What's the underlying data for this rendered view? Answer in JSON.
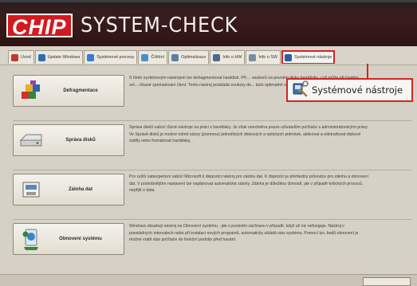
{
  "header": {
    "logo_text": "CHIP",
    "title": "SYSTEM-CHECK"
  },
  "tabs": [
    {
      "label": "Úvod",
      "icon": "home-icon",
      "color": "#c0392b"
    },
    {
      "label": "Update Windows",
      "icon": "globe-icon",
      "color": "#2e6fb0"
    },
    {
      "label": "Systémové procesy",
      "icon": "process-icon",
      "color": "#3a7bd5"
    },
    {
      "label": "Čištění",
      "icon": "broom-icon",
      "color": "#4a90c8"
    },
    {
      "label": "Optimalizace",
      "icon": "gauge-icon",
      "color": "#5b7fa8"
    },
    {
      "label": "Info o HW",
      "icon": "chip-icon",
      "color": "#4d6b8a"
    },
    {
      "label": "Info o SW",
      "icon": "window-icon",
      "color": "#7a8ea3"
    },
    {
      "label": "Systémové nástroje",
      "icon": "tools-icon",
      "color": "#2d5fa0"
    }
  ],
  "tools": [
    {
      "label": "Defragmentace",
      "icon": "defrag-icon",
      "description": "S tímto systémovým nástrojem lze defragmentovat harddisk. Při ... souborů na pevném disku harddisku, což může při častém vel... cíkané zpomalování čtení. Tento nástroj poskládá soubory do... bulo optimálně sekvenční a rychlé."
    },
    {
      "label": "Správa disků",
      "icon": "disk-icon",
      "description": "Správa disků nabízí různé nástroje na práci s harddisky. Je však umožněna pouze uživatelům počítače s administrátorskými právy. Ve Správě disků je možné měnit názvy (písmena) jednotlivých diskových a optických jednotek, aktivovat a odstraňovat diskové oddíly nebo formátovat harddisky."
    },
    {
      "label": "Záloha dat",
      "icon": "backup-icon",
      "description": "Pro vyšší zabezpečení nabízí Microsoft k dispozici nástroj pro zálohu dat. K dispozici je přehledný průvodce pro zálohu a obnovení dat. V podrobnějším nastavení lze naplánovat automatické zálohy. Záloha je důležitou činností, jak v případě kritických procesů, nepřijít o data."
    },
    {
      "label": "Obnovení systému",
      "icon": "restore-icon",
      "description": "Windows obsahují nástroj na Obnovení systému - jde o poslední záchranu v případě, když už nic nefunguje. Nástroj v pravidelných intervalech nebo při instalaci nových programů, automaticky ukládá stav systému. Pomocí tzv. bodů obnovení je možné vrátit stav počítače do funkční podoby před havárií."
    }
  ],
  "callout": {
    "label": "Systémové nástroje",
    "icon": "tools-icon"
  }
}
